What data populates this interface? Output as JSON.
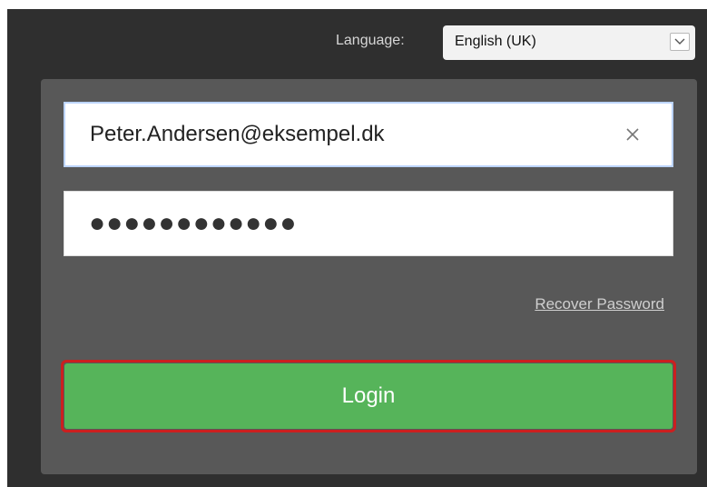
{
  "language": {
    "label": "Language:",
    "selected": "English (UK)"
  },
  "login_form": {
    "email_value": "Peter.Andersen@eksempel.dk",
    "password_masked": "●●●●●●●●●●●●",
    "recover_password_label": "Recover Password",
    "login_label": "Login"
  },
  "icons": {
    "clear": "close-icon",
    "dropdown": "chevron-down-icon"
  },
  "colors": {
    "background": "#2f2f2f",
    "panel": "#585858",
    "login_button": "#56b45a",
    "focus_outline": "#cc1f1f"
  }
}
